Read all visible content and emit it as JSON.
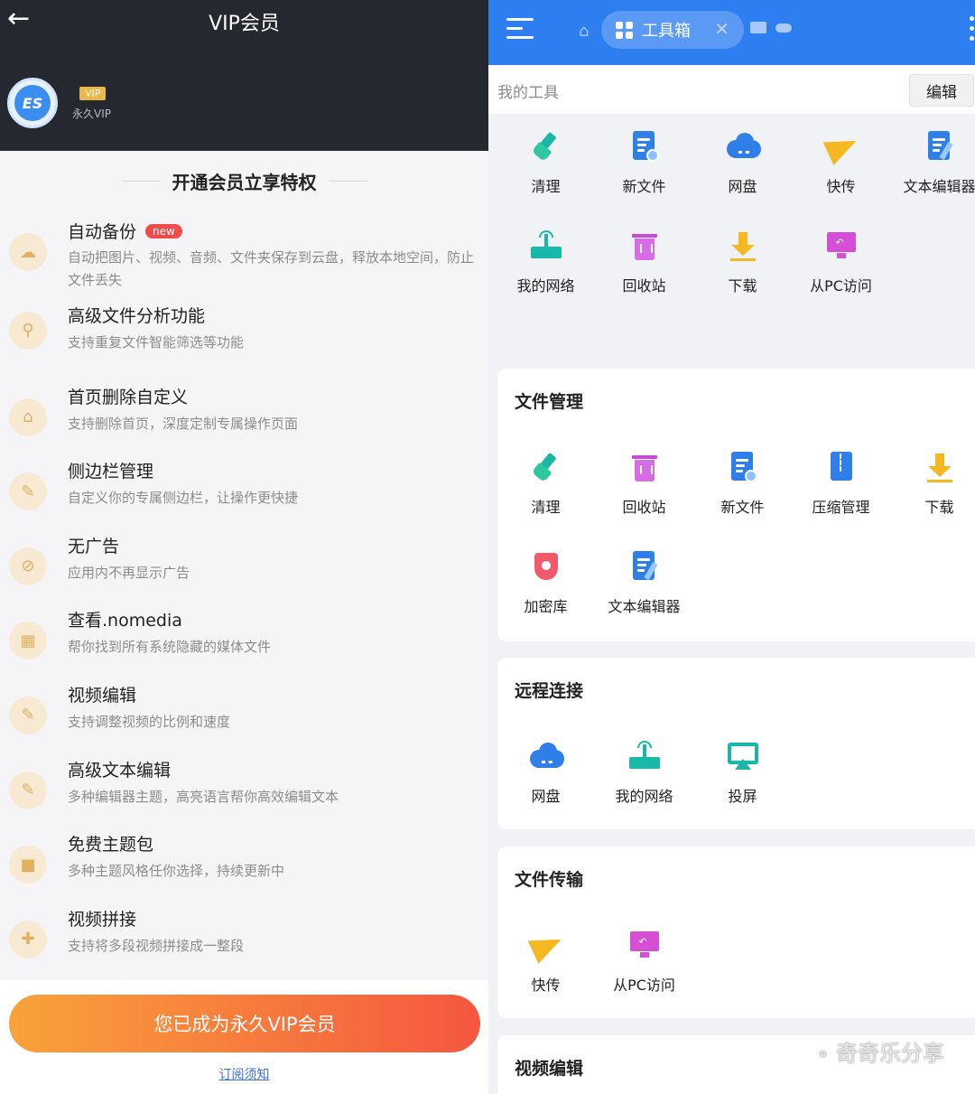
{
  "left": {
    "title": "VIP会员",
    "back_icon": "back-arrow-icon",
    "avatar_text": "ES",
    "vip_badge": "VIP",
    "vip_status": "永久VIP",
    "section_title": "开通会员立享特权",
    "features": [
      {
        "name": "自动备份",
        "badge": "new",
        "desc": "自动把图片、视频、音频、文件夹保存到云盘，释放本地空间，防止文件丢失",
        "icon": "cloud-sync-icon"
      },
      {
        "name": "高级文件分析功能",
        "desc": "支持重复文件智能筛选等功能",
        "icon": "search-file-icon"
      },
      {
        "name": "首页删除自定义",
        "desc": "支持删除首页，深度定制专属操作页面",
        "icon": "home-delete-icon"
      },
      {
        "name": "侧边栏管理",
        "desc": "自定义你的专属侧边栏，让操作更快捷",
        "icon": "sidebar-edit-icon"
      },
      {
        "name": "无广告",
        "desc": "应用内不再显示广告",
        "icon": "no-ad-icon"
      },
      {
        "name": "查看.nomedia",
        "desc": "帮你找到所有系统隐藏的媒体文件",
        "icon": "hidden-media-icon"
      },
      {
        "name": "视频编辑",
        "desc": "支持调整视频的比例和速度",
        "icon": "video-edit-icon"
      },
      {
        "name": "高级文本编辑",
        "desc": "多种编辑器主题，高亮语言帮你高效编辑文本",
        "icon": "text-edit-icon"
      },
      {
        "name": "免费主题包",
        "desc": "多种主题风格任你选择，持续更新中",
        "icon": "theme-shirt-icon"
      },
      {
        "name": "视频拼接",
        "desc": "支持将多段视频拼接成一整段",
        "icon": "video-merge-icon"
      }
    ],
    "cta": "您已成为永久VIP会员",
    "notice": "订阅须知"
  },
  "right": {
    "tab_label": "工具箱",
    "my_tools_label": "我的工具",
    "edit_label": "编辑",
    "my_tools": [
      {
        "name": "清理",
        "icon": "broom-icon"
      },
      {
        "name": "新文件",
        "icon": "new-file-icon"
      },
      {
        "name": "网盘",
        "icon": "cloud-drive-icon"
      },
      {
        "name": "快传",
        "icon": "paper-plane-icon"
      },
      {
        "name": "文本编辑器",
        "icon": "text-editor-icon"
      },
      {
        "name": "我的网络",
        "icon": "router-icon"
      },
      {
        "name": "回收站",
        "icon": "trash-icon"
      },
      {
        "name": "下载",
        "icon": "download-icon"
      },
      {
        "name": "从PC访问",
        "icon": "pc-access-icon"
      }
    ],
    "sections": {
      "file_mgmt": {
        "title": "文件管理",
        "tools": [
          {
            "name": "清理"
          },
          {
            "name": "回收站"
          },
          {
            "name": "新文件"
          },
          {
            "name": "压缩管理"
          },
          {
            "name": "下载"
          },
          {
            "name": "加密库"
          },
          {
            "name": "文本编辑器"
          }
        ]
      },
      "remote": {
        "title": "远程连接",
        "tools": [
          {
            "name": "网盘"
          },
          {
            "name": "我的网络"
          },
          {
            "name": "投屏"
          }
        ]
      },
      "transfer": {
        "title": "文件传输",
        "tools": [
          {
            "name": "快传"
          },
          {
            "name": "从PC访问"
          }
        ]
      },
      "video": {
        "title": "视频编辑"
      }
    },
    "watermark": "奇奇乐分享"
  },
  "colors": {
    "left_header": "#262830",
    "right_header": "#2d7ef0",
    "cta_start": "#f9a23a",
    "cta_end": "#f5573f",
    "accent_teal": "#1bb6a6",
    "accent_blue": "#2f7fe8",
    "accent_yellow": "#f5b820",
    "accent_purple": "#d44fd6"
  }
}
